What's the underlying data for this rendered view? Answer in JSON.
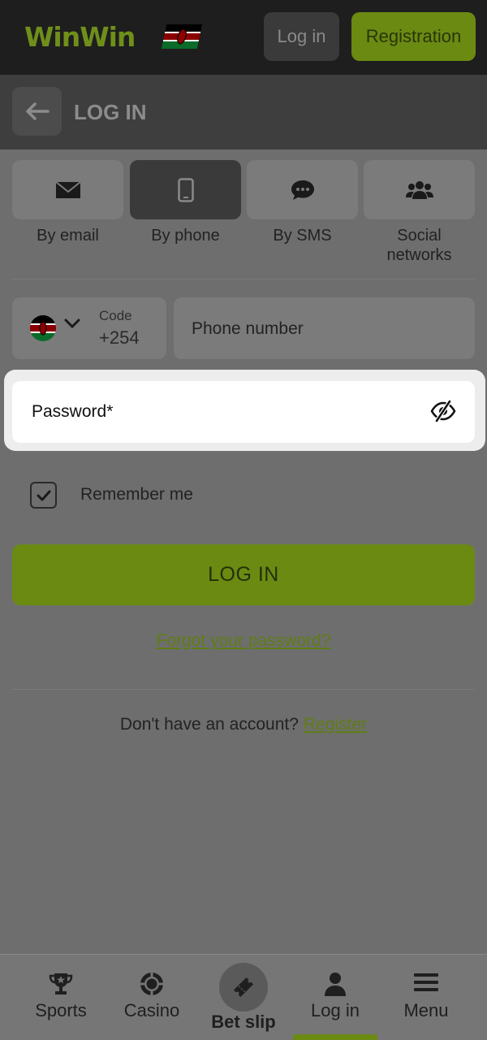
{
  "header": {
    "logo": "WinWin",
    "login_label": "Log in",
    "register_label": "Registration"
  },
  "titlebar": {
    "title": "LOG IN"
  },
  "tabs": [
    {
      "label": "By email",
      "icon": "envelope-icon"
    },
    {
      "label": "By phone",
      "icon": "phone-icon",
      "active": true
    },
    {
      "label": "By SMS",
      "icon": "chat-icon"
    },
    {
      "label": "Social networks",
      "icon": "users-icon"
    }
  ],
  "phone": {
    "code_caption": "Code",
    "code_value": "+254",
    "placeholder": "Phone number"
  },
  "password": {
    "label": "Password*"
  },
  "remember": {
    "label": "Remember me",
    "checked": true
  },
  "actions": {
    "login_label": "LOG IN",
    "forgot_label": "Forgot your password?",
    "no_account_text": "Don't have an account?",
    "register_link": "Register"
  },
  "bottom_nav": [
    {
      "label": "Sports",
      "icon": "trophy-icon"
    },
    {
      "label": "Casino",
      "icon": "chip-icon"
    },
    {
      "label": "Bet slip",
      "icon": "ticket-icon"
    },
    {
      "label": "Log in",
      "icon": "user-icon",
      "active": true
    },
    {
      "label": "Menu",
      "icon": "hamburger-icon"
    }
  ],
  "colors": {
    "accent": "#6a8a12",
    "header_bg": "#1e1e1e",
    "overlay_bg": "#6e6e6e"
  }
}
